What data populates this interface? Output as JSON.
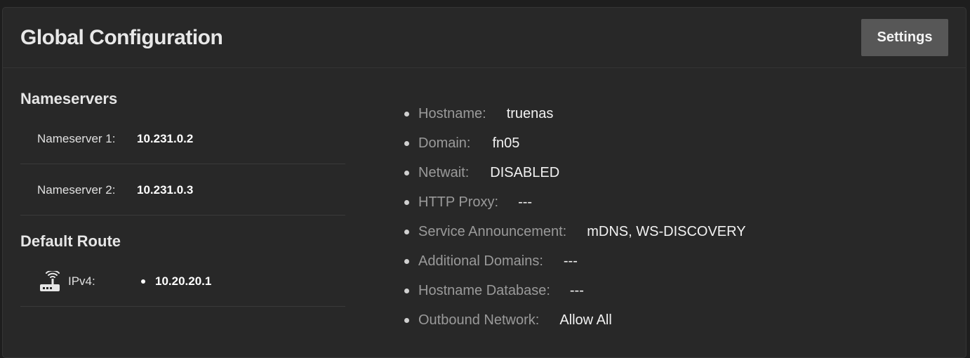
{
  "card": {
    "title": "Global Configuration",
    "settings_label": "Settings"
  },
  "nameservers": {
    "title": "Nameservers",
    "items": [
      {
        "label": "Nameserver 1:",
        "value": "10.231.0.2"
      },
      {
        "label": "Nameserver 2:",
        "value": "10.231.0.3"
      }
    ]
  },
  "default_route": {
    "title": "Default Route",
    "icon": "router-icon",
    "label": "IPv4:",
    "value": "10.20.20.1"
  },
  "info": {
    "items": [
      {
        "key": "Hostname:",
        "value": "truenas"
      },
      {
        "key": "Domain:",
        "value": "fn05"
      },
      {
        "key": "Netwait:",
        "value": "DISABLED"
      },
      {
        "key": "HTTP Proxy:",
        "value": "---"
      },
      {
        "key": "Service Announcement:",
        "value": "mDNS, WS-DISCOVERY"
      },
      {
        "key": "Additional Domains:",
        "value": "---"
      },
      {
        "key": "Hostname Database:",
        "value": "---"
      },
      {
        "key": "Outbound Network:",
        "value": "Allow All"
      }
    ]
  },
  "colors": {
    "background": "#1e1e1e",
    "card": "#282828",
    "button": "#575757",
    "muted_text": "#9a9a9a"
  }
}
